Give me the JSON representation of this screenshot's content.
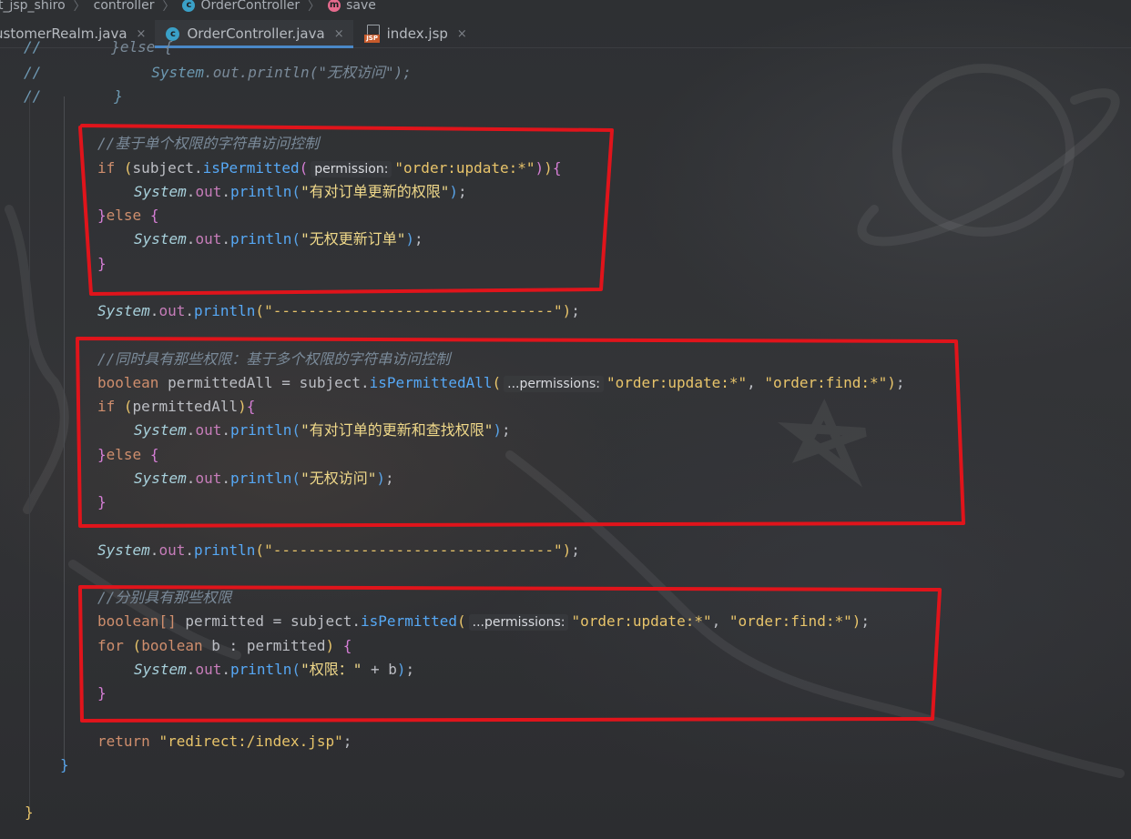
{
  "breadcrumb": {
    "items": [
      "t_jsp_shiro",
      "controller",
      "OrderController",
      "save"
    ],
    "icons": [
      "",
      "",
      "class-icon",
      "method-icon"
    ],
    "separator": "〉"
  },
  "tabs": [
    {
      "label": "ustomerRealm.java",
      "icon": "",
      "active": false
    },
    {
      "label": "OrderController.java",
      "icon": "class-icon",
      "active": true
    },
    {
      "label": "index.jsp",
      "icon": "jsp-file-icon",
      "active": false
    }
  ],
  "tab_close_glyph": "×",
  "class_icon_letter": "c",
  "method_icon_letter": "m",
  "jsp_icon_label": "JSP",
  "code": {
    "l1_comment": "//",
    "l1_text": "}else {",
    "l2_comment": "//",
    "l2_sys": "System",
    "l2_out": "out",
    "l2_println": "println",
    "l2_str": "\"无权访问\"",
    "l3_comment": "//",
    "l3_text": "}",
    "block1_comment": "//基于单个权限的字符串访问控制",
    "block1_if": "if",
    "block1_subject": "subject",
    "block1_method": "isPermitted",
    "block1_hint": "permission:",
    "block1_arg": "\"order:update:*\"",
    "block1_str_yes": "\"有对订单更新的权限\"",
    "block1_else": "else",
    "block1_str_no": "\"无权更新订单\"",
    "separator_str": "\"--------------------------------\"",
    "block2_comment": "//同时具有那些权限：基于多个权限的字符串访问控制",
    "block2_type": "boolean",
    "block2_var": "permittedAll",
    "block2_method": "isPermittedAll",
    "block2_hint": "...permissions:",
    "block2_arg1": "\"order:update:*\"",
    "block2_arg2": "\"order:find:*\"",
    "block2_str_yes": "\"有对订单的更新和查找权限\"",
    "block2_str_no": "\"无权访问\"",
    "block3_comment": "//分别具有那些权限",
    "block3_type": "boolean[]",
    "block3_var": "permitted",
    "block3_method": "isPermitted",
    "block3_hint": "...permissions:",
    "block3_arg1": "\"order:update:*\"",
    "block3_arg2": "\"order:find:*\"",
    "block3_for": "for",
    "block3_bool": "boolean",
    "block3_b": "b",
    "block3_str": "\"权限：\"",
    "return_kw": "return",
    "return_str": "\"redirect:/index.jsp\""
  },
  "colors": {
    "keyword": "#cf8e6d",
    "string": "#e8c46a",
    "comment": "#7a8a99",
    "method": "#56a8f5",
    "field": "#c77dba",
    "annotation_box": "#e0141b",
    "active_tab_underline": "#4a88c7"
  }
}
